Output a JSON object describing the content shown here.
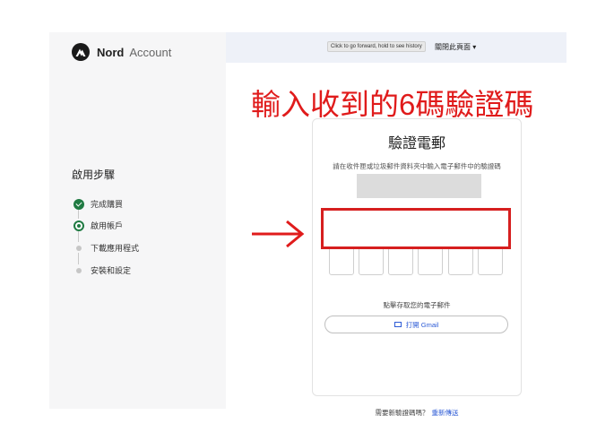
{
  "header": {
    "brand": "Nord",
    "product": "Account",
    "tooltip": "Click to go forward, hold to see history",
    "close_page": "關閉此頁面 ▾"
  },
  "sidebar": {
    "title": "啟用步驟",
    "steps": [
      {
        "label": "完成購買",
        "status": "done"
      },
      {
        "label": "啟用帳戶",
        "status": "current"
      },
      {
        "label": "下載應用程式",
        "status": "pending"
      },
      {
        "label": "安裝和設定",
        "status": "pending"
      }
    ]
  },
  "card": {
    "title": "驗證電郵",
    "description": "請在收件匣或垃圾郵件資料夾中輸入電子郵件中的驗證碼",
    "code_inputs": [
      "",
      "",
      "",
      "",
      "",
      ""
    ],
    "paste_text": "點擊存取您的電子郵件",
    "gmail_button": "打開 Gmail",
    "resend_prompt": "需要新驗證碼嗎？",
    "resend_link": "重新傳送"
  },
  "annotation": {
    "text": "輸入收到的6碼驗證碼",
    "color": "#e01b1b"
  },
  "colors": {
    "step_green": "#1f7a42",
    "link_blue": "#2d5bd6",
    "highlight_red": "#d61f1f"
  }
}
